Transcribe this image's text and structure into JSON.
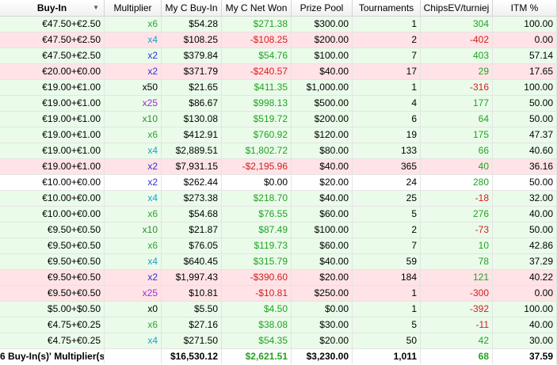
{
  "colors": {
    "green_text": "#22a322",
    "red_text": "#d11f1f",
    "row_green": "#eafbea",
    "row_red": "#ffe3e6",
    "mult_x2": "#2b35d8",
    "mult_x4": "#1aa3c9",
    "mult_x6": "#2fa52f",
    "mult_x10": "#2f8c2f",
    "mult_x25": "#9b2fd1"
  },
  "headers": [
    "Buy-In",
    "Multiplier",
    "My C Buy-In",
    "My C Net Won",
    "Prize Pool",
    "Tournaments",
    "ChipsEV/turniej",
    "ITM %"
  ],
  "rows": [
    {
      "bg": "green",
      "buyin": "€47.50+€2.50",
      "mult": "x6",
      "mult_color": "#2fa52f",
      "my_buyin": "$54.28",
      "net": "$271.38",
      "net_sign": "pos",
      "pool": "$300.00",
      "tourn": "1",
      "ev": "304",
      "ev_sign": "pos",
      "itm": "100.00"
    },
    {
      "bg": "red",
      "buyin": "€47.50+€2.50",
      "mult": "x4",
      "mult_color": "#1aa3c9",
      "my_buyin": "$108.25",
      "net": "-$108.25",
      "net_sign": "neg",
      "pool": "$200.00",
      "tourn": "2",
      "ev": "-402",
      "ev_sign": "neg",
      "itm": "0.00"
    },
    {
      "bg": "green",
      "buyin": "€47.50+€2.50",
      "mult": "x2",
      "mult_color": "#2b35d8",
      "my_buyin": "$379.84",
      "net": "$54.76",
      "net_sign": "pos",
      "pool": "$100.00",
      "tourn": "7",
      "ev": "403",
      "ev_sign": "pos",
      "itm": "57.14"
    },
    {
      "bg": "red",
      "buyin": "€20.00+€0.00",
      "mult": "x2",
      "mult_color": "#2b35d8",
      "my_buyin": "$371.79",
      "net": "-$240.57",
      "net_sign": "neg",
      "pool": "$40.00",
      "tourn": "17",
      "ev": "29",
      "ev_sign": "pos",
      "itm": "17.65"
    },
    {
      "bg": "green",
      "buyin": "€19.00+€1.00",
      "mult": "x50",
      "mult_color": "#000000",
      "my_buyin": "$21.65",
      "net": "$411.35",
      "net_sign": "pos",
      "pool": "$1,000.00",
      "tourn": "1",
      "ev": "-316",
      "ev_sign": "neg",
      "itm": "100.00"
    },
    {
      "bg": "green",
      "buyin": "€19.00+€1.00",
      "mult": "x25",
      "mult_color": "#9b2fd1",
      "my_buyin": "$86.67",
      "net": "$998.13",
      "net_sign": "pos",
      "pool": "$500.00",
      "tourn": "4",
      "ev": "177",
      "ev_sign": "pos",
      "itm": "50.00"
    },
    {
      "bg": "green",
      "buyin": "€19.00+€1.00",
      "mult": "x10",
      "mult_color": "#2f8c2f",
      "my_buyin": "$130.08",
      "net": "$519.72",
      "net_sign": "pos",
      "pool": "$200.00",
      "tourn": "6",
      "ev": "64",
      "ev_sign": "pos",
      "itm": "50.00"
    },
    {
      "bg": "green",
      "buyin": "€19.00+€1.00",
      "mult": "x6",
      "mult_color": "#2fa52f",
      "my_buyin": "$412.91",
      "net": "$760.92",
      "net_sign": "pos",
      "pool": "$120.00",
      "tourn": "19",
      "ev": "175",
      "ev_sign": "pos",
      "itm": "47.37"
    },
    {
      "bg": "green",
      "buyin": "€19.00+€1.00",
      "mult": "x4",
      "mult_color": "#1aa3c9",
      "my_buyin": "$2,889.51",
      "net": "$1,802.72",
      "net_sign": "pos",
      "pool": "$80.00",
      "tourn": "133",
      "ev": "66",
      "ev_sign": "pos",
      "itm": "40.60"
    },
    {
      "bg": "red",
      "buyin": "€19.00+€1.00",
      "mult": "x2",
      "mult_color": "#2b35d8",
      "my_buyin": "$7,931.15",
      "net": "-$2,195.96",
      "net_sign": "neg",
      "pool": "$40.00",
      "tourn": "365",
      "ev": "40",
      "ev_sign": "pos",
      "itm": "36.16"
    },
    {
      "bg": "white",
      "buyin": "€10.00+€0.00",
      "mult": "x2",
      "mult_color": "#2b35d8",
      "my_buyin": "$262.44",
      "net": "$0.00",
      "net_sign": "zero",
      "pool": "$20.00",
      "tourn": "24",
      "ev": "280",
      "ev_sign": "pos",
      "itm": "50.00"
    },
    {
      "bg": "green",
      "buyin": "€10.00+€0.00",
      "mult": "x4",
      "mult_color": "#1aa3c9",
      "my_buyin": "$273.38",
      "net": "$218.70",
      "net_sign": "pos",
      "pool": "$40.00",
      "tourn": "25",
      "ev": "-18",
      "ev_sign": "neg",
      "itm": "32.00"
    },
    {
      "bg": "green",
      "buyin": "€10.00+€0.00",
      "mult": "x6",
      "mult_color": "#2fa52f",
      "my_buyin": "$54.68",
      "net": "$76.55",
      "net_sign": "pos",
      "pool": "$60.00",
      "tourn": "5",
      "ev": "276",
      "ev_sign": "pos",
      "itm": "40.00"
    },
    {
      "bg": "green",
      "buyin": "€9.50+€0.50",
      "mult": "x10",
      "mult_color": "#2f8c2f",
      "my_buyin": "$21.87",
      "net": "$87.49",
      "net_sign": "pos",
      "pool": "$100.00",
      "tourn": "2",
      "ev": "-73",
      "ev_sign": "neg",
      "itm": "50.00"
    },
    {
      "bg": "green",
      "buyin": "€9.50+€0.50",
      "mult": "x6",
      "mult_color": "#2fa52f",
      "my_buyin": "$76.05",
      "net": "$119.73",
      "net_sign": "pos",
      "pool": "$60.00",
      "tourn": "7",
      "ev": "10",
      "ev_sign": "pos",
      "itm": "42.86"
    },
    {
      "bg": "green",
      "buyin": "€9.50+€0.50",
      "mult": "x4",
      "mult_color": "#1aa3c9",
      "my_buyin": "$640.45",
      "net": "$315.79",
      "net_sign": "pos",
      "pool": "$40.00",
      "tourn": "59",
      "ev": "78",
      "ev_sign": "pos",
      "itm": "37.29"
    },
    {
      "bg": "red",
      "buyin": "€9.50+€0.50",
      "mult": "x2",
      "mult_color": "#2b35d8",
      "my_buyin": "$1,997.43",
      "net": "-$390.60",
      "net_sign": "neg",
      "pool": "$20.00",
      "tourn": "184",
      "ev": "121",
      "ev_sign": "pos",
      "itm": "40.22"
    },
    {
      "bg": "red",
      "buyin": "€9.50+€0.50",
      "mult": "x25",
      "mult_color": "#9b2fd1",
      "my_buyin": "$10.81",
      "net": "-$10.81",
      "net_sign": "neg",
      "pool": "$250.00",
      "tourn": "1",
      "ev": "-300",
      "ev_sign": "neg",
      "itm": "0.00"
    },
    {
      "bg": "green",
      "buyin": "$5.00+$0.50",
      "mult": "x0",
      "mult_color": "#000000",
      "my_buyin": "$5.50",
      "net": "$4.50",
      "net_sign": "pos",
      "pool": "$0.00",
      "tourn": "1",
      "ev": "-392",
      "ev_sign": "neg",
      "itm": "100.00"
    },
    {
      "bg": "green",
      "buyin": "€4.75+€0.25",
      "mult": "x6",
      "mult_color": "#2fa52f",
      "my_buyin": "$27.16",
      "net": "$38.08",
      "net_sign": "pos",
      "pool": "$30.00",
      "tourn": "5",
      "ev": "-11",
      "ev_sign": "neg",
      "itm": "40.00"
    },
    {
      "bg": "green",
      "buyin": "€4.75+€0.25",
      "mult": "x4",
      "mult_color": "#1aa3c9",
      "my_buyin": "$271.50",
      "net": "$54.35",
      "net_sign": "pos",
      "pool": "$20.00",
      "tourn": "50",
      "ev": "42",
      "ev_sign": "pos",
      "itm": "30.00"
    }
  ],
  "totals": {
    "label": "6 Buy-In(s)' Multiplier(s)",
    "my_buyin": "$16,530.12",
    "net": "$2,621.51",
    "pool": "$3,230.00",
    "tourn": "1,011",
    "ev": "68",
    "itm": "37.59"
  }
}
